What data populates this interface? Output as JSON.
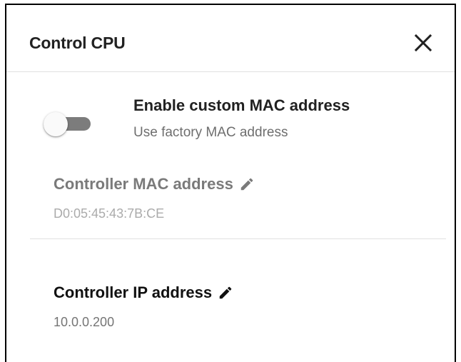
{
  "dialog": {
    "title": "Control CPU",
    "close_icon": "close-icon"
  },
  "mac_toggle": {
    "title": "Enable custom MAC address",
    "subtitle": "Use factory MAC address",
    "enabled": false
  },
  "controller_mac": {
    "label": "Controller MAC address",
    "value": "D0:05:45:43:7B:CE",
    "edit_icon": "pencil-icon",
    "disabled": true
  },
  "controller_ip": {
    "label": "Controller IP address",
    "value": "10.0.0.200",
    "edit_icon": "pencil-icon"
  },
  "colors": {
    "title_text": "#212121",
    "disabled_label": "#7a7a7a",
    "disabled_value": "#ababab",
    "value_text": "#757575",
    "divider": "#e0e0e0",
    "toggle_track_off": "#7c7c7c"
  }
}
